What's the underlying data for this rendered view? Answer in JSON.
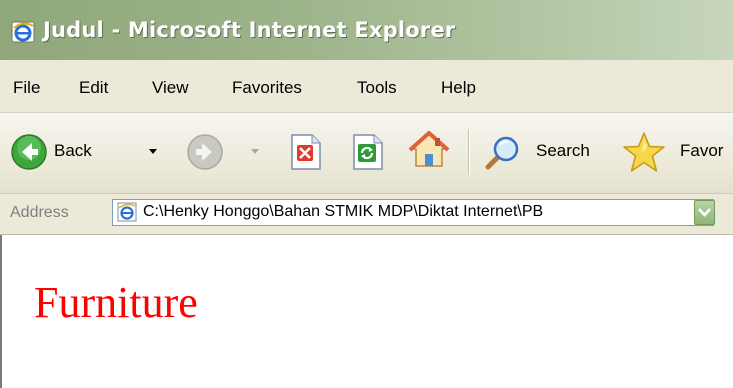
{
  "window": {
    "title": "Judul - Microsoft Internet Explorer",
    "icon": "ie-icon"
  },
  "menu": {
    "items": [
      {
        "label": "File"
      },
      {
        "label": "Edit"
      },
      {
        "label": "View"
      },
      {
        "label": "Favorites"
      },
      {
        "label": "Tools"
      },
      {
        "label": "Help"
      }
    ]
  },
  "toolbar": {
    "back_label": "Back",
    "search_label": "Search",
    "favorites_label": "Favor",
    "icons": [
      "back-icon",
      "back-dropdown-icon",
      "forward-icon",
      "forward-dropdown-icon",
      "stop-icon",
      "refresh-icon",
      "home-icon",
      "search-icon",
      "favorites-star-icon"
    ]
  },
  "address": {
    "label": "Address",
    "value": "C:\\Henky Honggo\\Bahan STMIK MDP\\Diktat Internet\\PB"
  },
  "page": {
    "heading": "Furniture",
    "heading_color": "#ff0000"
  }
}
